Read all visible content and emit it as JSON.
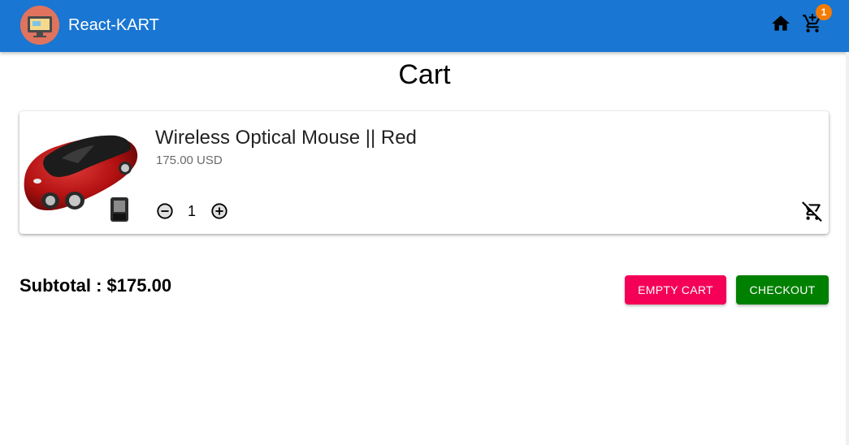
{
  "header": {
    "brand": "React-KART",
    "cart_count": "1",
    "icons": {
      "logo": "computer-logo",
      "home": "home-icon",
      "cart": "shopping-cart-icon"
    },
    "color": "#1976d2"
  },
  "page": {
    "title": "Cart"
  },
  "cart_items": [
    {
      "name": "Wireless Optical Mouse || Red",
      "price": "175.00 USD",
      "quantity": "1",
      "image": "car-shaped-mouse"
    }
  ],
  "summary": {
    "subtotal": "Subtotal : $175.00"
  },
  "actions": {
    "empty_cart": "EMPTY CART",
    "checkout": "CHECKOUT",
    "empty_color": "#f50057",
    "checkout_color": "#008000"
  }
}
